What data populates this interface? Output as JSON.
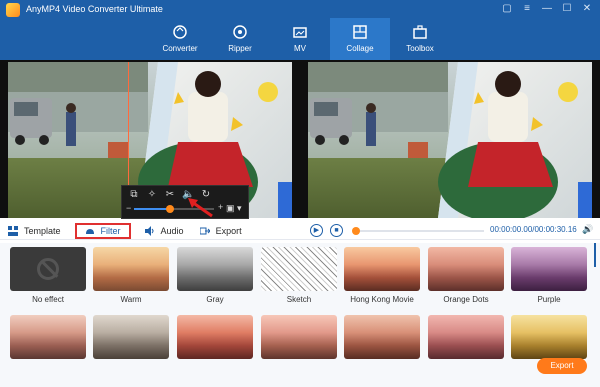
{
  "app": {
    "title": "AnyMP4 Video Converter Ultimate"
  },
  "window_controls": [
    "chat-icon",
    "menu-icon",
    "minimize-icon",
    "maximize-icon",
    "close-icon"
  ],
  "nav": [
    {
      "label": "Converter",
      "icon": "converter-icon",
      "active": false
    },
    {
      "label": "Ripper",
      "icon": "ripper-icon",
      "active": false
    },
    {
      "label": "MV",
      "icon": "mv-icon",
      "active": false
    },
    {
      "label": "Collage",
      "icon": "collage-icon",
      "active": true
    },
    {
      "label": "Toolbox",
      "icon": "toolbox-icon",
      "active": false
    }
  ],
  "edit_toolbar": {
    "icons": [
      "replace-icon",
      "magic-icon",
      "cut-icon",
      "volume-icon",
      "rotate-icon"
    ],
    "minus": "−",
    "plus": "+",
    "zoom_fraction": 0.45
  },
  "tabs": [
    {
      "label": "Template",
      "icon": "template-icon"
    },
    {
      "label": "Filter",
      "icon": "filter-icon",
      "active": true
    },
    {
      "label": "Audio",
      "icon": "audio-icon"
    },
    {
      "label": "Export",
      "icon": "export-icon"
    }
  ],
  "playback": {
    "time": "00:00:00.00/00:00:30.16",
    "progress_fraction": 0.0
  },
  "filters": [
    {
      "label": "No effect"
    },
    {
      "label": "Warm"
    },
    {
      "label": "Gray"
    },
    {
      "label": "Sketch"
    },
    {
      "label": "Hong Kong Movie"
    },
    {
      "label": "Orange Dots"
    },
    {
      "label": "Purple"
    },
    {
      "label": ""
    },
    {
      "label": ""
    },
    {
      "label": ""
    },
    {
      "label": ""
    },
    {
      "label": ""
    },
    {
      "label": ""
    },
    {
      "label": ""
    }
  ],
  "export_button": "Export",
  "colors": {
    "brand_blue": "#1e5fa8",
    "active_tab_blue": "#2c78c9",
    "accent_orange": "#ff7a1a",
    "highlight_red": "#e03030"
  }
}
